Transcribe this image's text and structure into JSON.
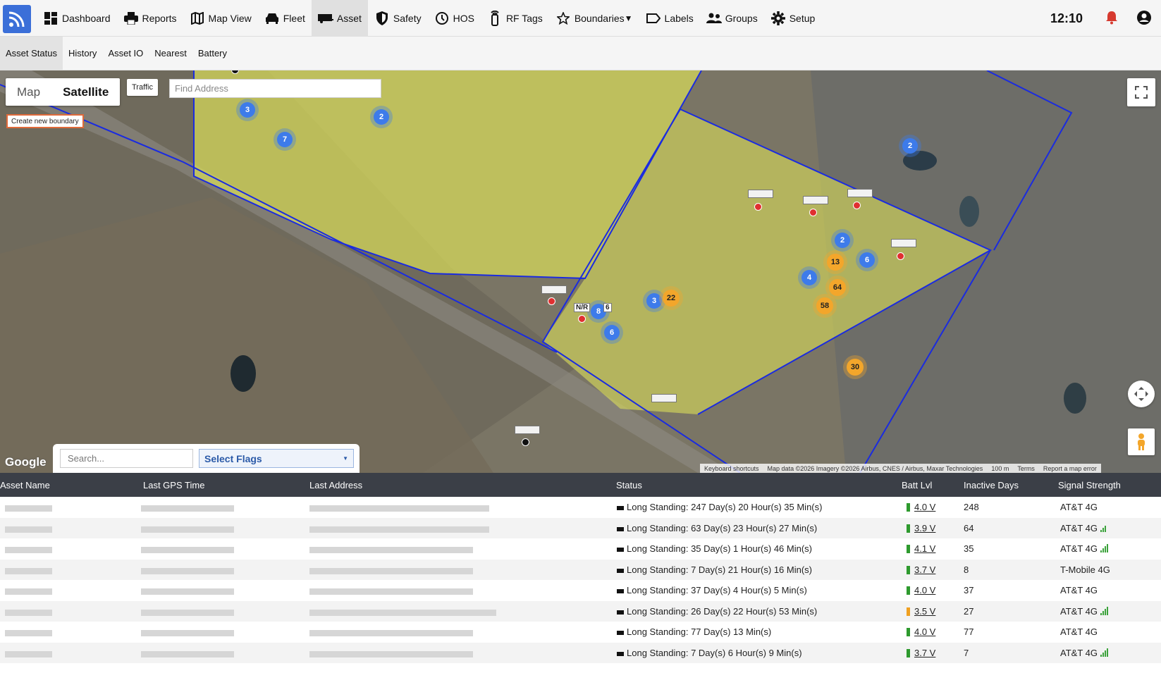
{
  "nav": {
    "items": [
      {
        "label": "Dashboard",
        "icon": "dashboard-icon"
      },
      {
        "label": "Reports",
        "icon": "printer-icon"
      },
      {
        "label": "Map View",
        "icon": "map-icon"
      },
      {
        "label": "Fleet",
        "icon": "car-icon"
      },
      {
        "label": "Asset",
        "icon": "trailer-icon",
        "active": true
      },
      {
        "label": "Safety",
        "icon": "shield-icon"
      },
      {
        "label": "HOS",
        "icon": "clock-icon"
      },
      {
        "label": "RF Tags",
        "icon": "rf-tag-icon"
      },
      {
        "label": "Boundaries",
        "icon": "star-icon",
        "dropdown": true
      },
      {
        "label": "Labels",
        "icon": "label-icon"
      },
      {
        "label": "Groups",
        "icon": "groups-icon"
      },
      {
        "label": "Setup",
        "icon": "gear-icon"
      }
    ],
    "clock": "12:10",
    "accent": "#3b6fd8"
  },
  "subnav": [
    "Asset Status",
    "History",
    "Asset IO",
    "Nearest",
    "Battery"
  ],
  "map": {
    "maptype": [
      "Map",
      "Satellite"
    ],
    "traffic": "Traffic",
    "find_address_placeholder": "Find Address",
    "create_boundary": "Create new boundary",
    "google": "Google",
    "road_label": "N/R",
    "road_label2": "6",
    "attribution": [
      "Keyboard shortcuts",
      "Map data ©2026 Imagery ©2026 Airbus, CNES / Airbus, Maxar Technologies",
      "100 m",
      "Terms",
      "Report a map error"
    ],
    "search_placeholder": "Search...",
    "flags_label": "Select Flags",
    "clusters_blue": [
      "3",
      "2",
      "7",
      "2",
      "2",
      "6",
      "4",
      "8",
      "6",
      "3"
    ],
    "clusters_orange": [
      "13",
      "64",
      "58",
      "22",
      "30"
    ]
  },
  "table": {
    "headers": [
      "Asset Name",
      "Last GPS Time",
      "Last Address",
      "Status",
      "Batt Lvl",
      "Inactive Days",
      "Signal Strength"
    ],
    "rows": [
      {
        "status": "Long Standing: 247 Day(s) 20 Hour(s) 35 Min(s)",
        "volt": "4.0 V",
        "days": "248",
        "signal": "AT&T 4G",
        "bars": 0,
        "batt": "ok"
      },
      {
        "status": "Long Standing: 63 Day(s) 23 Hour(s) 27 Min(s)",
        "volt": "3.9 V",
        "days": "64",
        "signal": "AT&T 4G",
        "bars": 3,
        "batt": "ok"
      },
      {
        "status": "Long Standing: 35 Day(s) 1 Hour(s) 46 Min(s)",
        "volt": "4.1 V",
        "days": "35",
        "signal": "AT&T 4G",
        "bars": 4,
        "batt": "ok"
      },
      {
        "status": "Long Standing: 7 Day(s) 21 Hour(s) 16 Min(s)",
        "volt": "3.7 V",
        "days": "8",
        "signal": "T-Mobile 4G",
        "bars": 0,
        "batt": "ok"
      },
      {
        "status": "Long Standing: 37 Day(s) 4 Hour(s) 5 Min(s)",
        "volt": "4.0 V",
        "days": "37",
        "signal": "AT&T 4G",
        "bars": 0,
        "batt": "ok"
      },
      {
        "status": "Long Standing: 26 Day(s) 22 Hour(s) 53 Min(s)",
        "volt": "3.5 V",
        "days": "27",
        "signal": "AT&T 4G",
        "bars": 4,
        "batt": "low"
      },
      {
        "status": "Long Standing: 77 Day(s) 13 Min(s)",
        "volt": "4.0 V",
        "days": "77",
        "signal": "AT&T 4G",
        "bars": 0,
        "batt": "ok"
      },
      {
        "status": "Long Standing: 7 Day(s) 6 Hour(s) 9 Min(s)",
        "volt": "3.7 V",
        "days": "7",
        "signal": "AT&T 4G",
        "bars": 4,
        "batt": "ok"
      }
    ]
  }
}
